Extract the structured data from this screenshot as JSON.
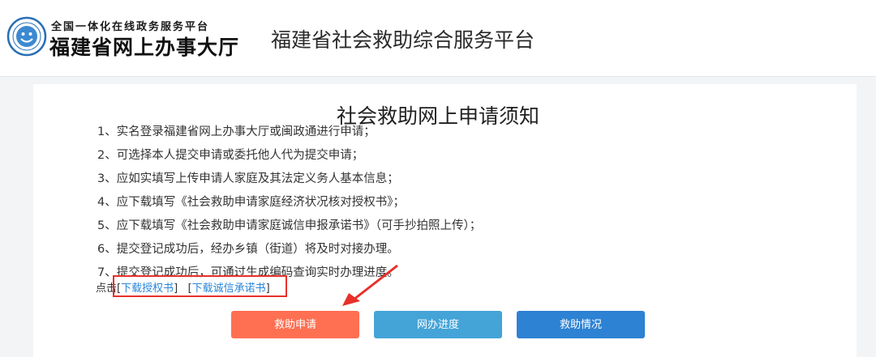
{
  "header": {
    "logo_top": "全国一体化在线政务服务平台",
    "logo_main": "福建省网上办事大厅",
    "platform_title": "福建省社会救助综合服务平台"
  },
  "notice": {
    "title": "社会救助网上申请须知",
    "rules": [
      "1、实名登录福建省网上办事大厅或闽政通进行申请；",
      "2、可选择本人提交申请或委托他人代为提交申请；",
      "3、应如实填写上传申请人家庭及其法定义务人基本信息；",
      "4、应下载填写《社会救助申请家庭经济状况核对授权书》；",
      "5、应下载填写《社会救助申请家庭诚信申报承诺书》（可手抄拍照上传）；",
      "6、提交登记成功后，经办乡镇（街道）将及时对接办理。",
      "7、提交登记成功后，可通过生成编码查询实时办理进度。"
    ],
    "download": {
      "prefix": "点击",
      "auth_link": "下载授权书",
      "pledge_link": "下载诚信承诺书"
    }
  },
  "buttons": {
    "apply": "救助申请",
    "progress": "网办进度",
    "status": "救助情况"
  },
  "colors": {
    "apply": "#ff7052",
    "progress": "#44a4d8",
    "status": "#2e82d3",
    "highlight": "#e8302a",
    "link": "#2a86d8"
  },
  "icons": {
    "emblem": "smiling-face-emblem-icon",
    "annotation": "red-arrow-icon"
  }
}
